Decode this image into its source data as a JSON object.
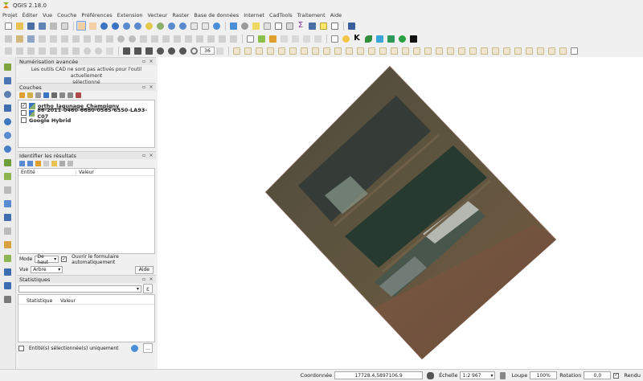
{
  "window": {
    "title": "QGIS 2.18.0"
  },
  "menu": [
    "Projet",
    "Éditer",
    "Vue",
    "Couche",
    "Préférences",
    "Extension",
    "Vecteur",
    "Raster",
    "Base de données",
    "Internet",
    "CadTools",
    "Traitement",
    "Aide"
  ],
  "toolbar": {
    "zoom_value": "36"
  },
  "advanced_digitizing": {
    "title": "Numérisation avancée",
    "message_line1": "Les outils CAD ne sont pas activés pour l'outil actuellement",
    "message_line2": "sélectionné"
  },
  "layers": {
    "title": "Couches",
    "items": [
      {
        "name": "ortho_lagunage_Champigny",
        "checked": "✓"
      },
      {
        "name": "86-2011-0460-6680-0565-6550-LA93-C07",
        "checked": ""
      },
      {
        "name": "Google Hybrid",
        "checked": ""
      }
    ]
  },
  "identify": {
    "title": "Identifier les résultats",
    "col_entity": "Entité",
    "col_value": "Valeur",
    "mode_label": "Mode",
    "mode_value": "De haut",
    "auto_open_label": "Ouvrir le formulaire automatiquement",
    "view_label": "Vue",
    "view_value": "Arbre",
    "help_label": "Aide"
  },
  "statistics": {
    "title": "Statistiques",
    "col_stat": "Statistique",
    "col_value": "Valeur",
    "selected_only_label": "Entité(s) sélectionnée(s) uniquement"
  },
  "status": {
    "coord_label": "Coordonnée",
    "coord_value": "17728.4,5897106.9",
    "scale_label": "Échelle",
    "scale_value": "1:2 967",
    "magnifier_label": "Loupe",
    "magnifier_value": "100%",
    "rotation_label": "Rotation",
    "rotation_value": "0,0",
    "render_label": "Rendu",
    "render_checked": "✓"
  },
  "colors": {
    "accent": "#3a74c4",
    "map_bg": "#ffffff",
    "field_brown": "#6e5138",
    "pond_dark": "#2f3b33"
  }
}
